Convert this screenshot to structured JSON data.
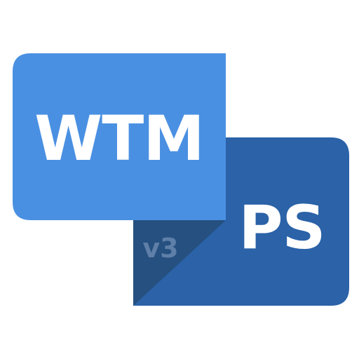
{
  "icon": {
    "top_card": {
      "label": "WTM",
      "fill": "#4A90E2",
      "text_color": "#FFFFFF"
    },
    "bottom_card": {
      "label": "PS",
      "fill": "#2B62A8",
      "text_color": "#FFFFFF",
      "corner_fill": "#25507F"
    },
    "version": {
      "label": "v3",
      "text_color": "#5E7FA8"
    }
  }
}
